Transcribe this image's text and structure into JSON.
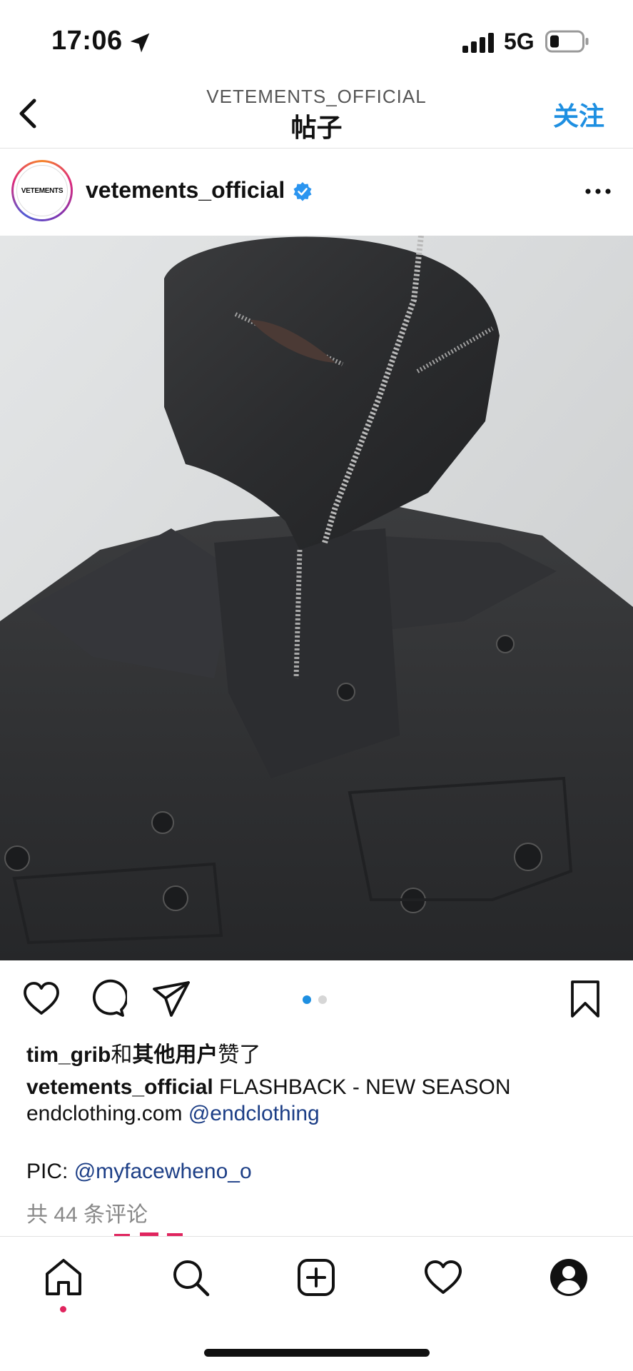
{
  "status_bar": {
    "time": "17:06",
    "network": "5G"
  },
  "header": {
    "subtitle": "VETEMENTS_OFFICIAL",
    "title": "帖子",
    "follow_label": "关注"
  },
  "post": {
    "author": "vetements_official",
    "avatar_text": "VETEMENTS",
    "verified": true,
    "carousel": {
      "total": 2,
      "active": 1,
      "active_color": "#1e8fe1",
      "inactive_color": "#d6d6d6"
    },
    "likes": {
      "user": "tim_grib",
      "connector": "和",
      "others": "其他用户",
      "suffix": "赞了"
    },
    "caption": {
      "user": "vetements_official",
      "text": "FLASHBACK - NEW SEASON",
      "line2_text": "endclothing.com",
      "line2_mention": "@endclothing",
      "pic_label": "PIC:",
      "pic_mention": "@myfacewheno_o"
    },
    "comments_link": "共 44 条评论"
  },
  "colors": {
    "accent": "#1e8fe1",
    "mention": "#1c3e86",
    "notification": "#e0245e"
  },
  "icons": {
    "status": [
      "location-arrow-icon",
      "signal-icon",
      "battery-icon"
    ],
    "header": [
      "back-icon"
    ],
    "post": [
      "verified-icon",
      "more-icon",
      "like-icon",
      "comment-icon",
      "share-icon",
      "save-icon"
    ],
    "tabs": [
      "home-icon",
      "search-icon",
      "new-post-icon",
      "activity-icon",
      "profile-icon"
    ]
  }
}
